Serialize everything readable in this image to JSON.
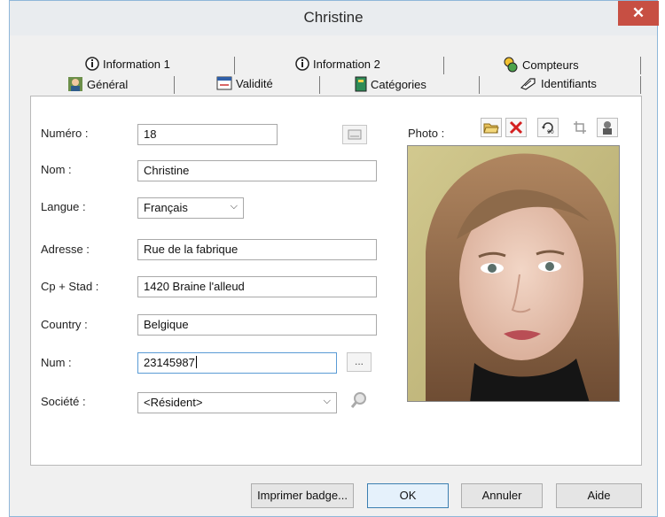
{
  "window": {
    "title": "Christine",
    "close_glyph": "✕"
  },
  "tabs": {
    "back_row": [
      {
        "label": "Information 1",
        "icon": "info-icon"
      },
      {
        "label": "Information 2",
        "icon": "info-icon"
      },
      {
        "label": "Compteurs",
        "icon": "counters-icon"
      }
    ],
    "front_row": [
      {
        "label": "Général",
        "icon": "user-icon"
      },
      {
        "label": "Validité",
        "icon": "calendar-icon"
      },
      {
        "label": "Catégories",
        "icon": "book-icon"
      },
      {
        "label": "Identifiants",
        "icon": "key-icon"
      }
    ]
  },
  "form": {
    "numero_label": "Numéro :",
    "numero_value": "18",
    "nom_label": "Nom :",
    "nom_value": "Christine",
    "langue_label": "Langue :",
    "langue_value": "Français",
    "adresse_label": "Adresse :",
    "adresse_value": "Rue de la fabrique",
    "cp_label": "Cp + Stad :",
    "cp_value": "1420 Braine l'alleud",
    "country_label": "Country :",
    "country_value": "Belgique",
    "num_label": "Num :",
    "num_value": "23145987",
    "num_button": "...",
    "societe_label": "Société :",
    "societe_value": "<Résident>"
  },
  "photo": {
    "label": "Photo :",
    "tools": [
      "open-folder-icon",
      "delete-icon",
      "rotate-icon",
      "crop-icon",
      "camera-icon"
    ]
  },
  "buttons": {
    "print": "Imprimer badge...",
    "ok": "OK",
    "cancel": "Annuler",
    "help": "Aide"
  },
  "colors": {
    "close": "#c74f43",
    "accent": "#3c7fb1"
  }
}
